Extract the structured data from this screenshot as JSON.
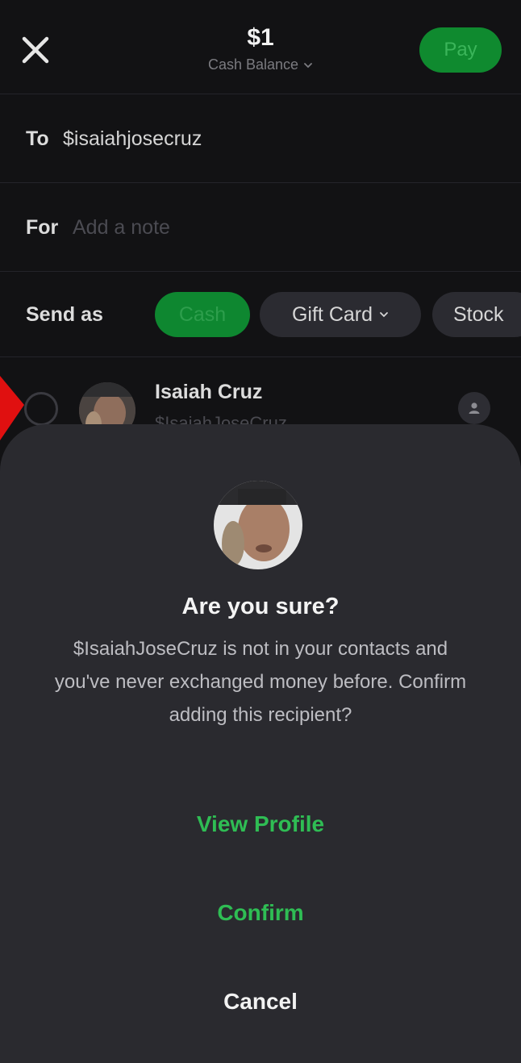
{
  "header": {
    "amount": "$1",
    "balance_source": "Cash Balance",
    "pay_label": "Pay"
  },
  "form": {
    "to_label": "To",
    "to_value": "$isaiahjosecruz",
    "for_label": "For",
    "note_placeholder": "Add a note",
    "send_as_label": "Send as",
    "send_as_options": [
      {
        "label": "Cash",
        "selected": true
      },
      {
        "label": "Gift Card",
        "selected": false
      },
      {
        "label": "Stock",
        "selected": false
      }
    ]
  },
  "contact": {
    "name": "Isaiah Cruz",
    "handle": "$IsaiahJoseCruz"
  },
  "dialog": {
    "title": "Are you sure?",
    "message": "$IsaiahJoseCruz is not in your contacts and you've never exchanged money before. Confirm adding this recipient?",
    "view_profile_label": "View Profile",
    "confirm_label": "Confirm",
    "cancel_label": "Cancel"
  },
  "colors": {
    "accent_green": "#2fbd54",
    "chip_green": "#0e8730",
    "background": "#121214",
    "sheet": "#2a2a2f",
    "marker_red": "#e01010"
  },
  "icons": [
    "close-icon",
    "chevron-down-icon",
    "person-icon",
    "arrow-marker-icon"
  ]
}
